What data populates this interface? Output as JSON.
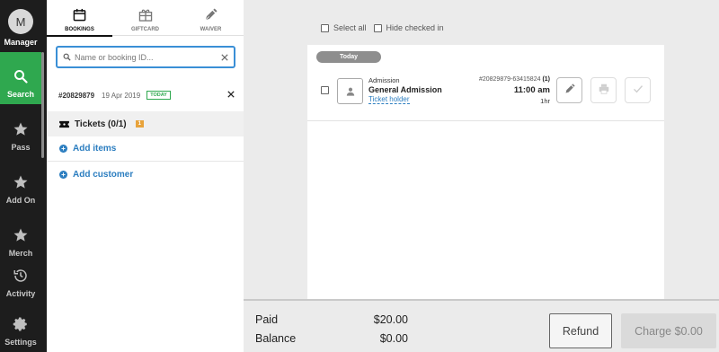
{
  "nav": {
    "manager": {
      "initial": "M",
      "label": "Manager"
    },
    "items": [
      {
        "label": "Search",
        "icon": "search-icon",
        "active": true
      },
      {
        "label": "Pass",
        "icon": "star-icon"
      },
      {
        "label": "Add On",
        "icon": "star-icon"
      },
      {
        "label": "Merch",
        "icon": "star-icon"
      },
      {
        "label": "Activity",
        "icon": "history-icon"
      },
      {
        "label": "Settings",
        "icon": "gear-icon"
      }
    ]
  },
  "tabs": [
    {
      "label": "BOOKINGS",
      "icon": "calendar-icon",
      "active": true
    },
    {
      "label": "GIFTCARD",
      "icon": "gift-icon"
    },
    {
      "label": "WAIVER",
      "icon": "pen-icon"
    }
  ],
  "search": {
    "placeholder": "Name or booking ID...",
    "value": ""
  },
  "booking": {
    "number": "#20829879",
    "date": "19 Apr 2019",
    "badge": "TODAY"
  },
  "tickets": {
    "label": "Tickets (0/1)",
    "count": "1"
  },
  "actions": {
    "add_items": "Add items",
    "add_customer": "Add customer"
  },
  "filters": {
    "select_all": "Select all",
    "hide_checked_in": "Hide checked in"
  },
  "day_label": "Today",
  "ticket": {
    "type": "Admission",
    "name": "General Admission",
    "holder": "Ticket holder",
    "ref": "#20829879-63415824",
    "qty": "(1)",
    "time": "11:00 am",
    "duration": "1hr"
  },
  "totals": {
    "paid_label": "Paid",
    "paid_value": "$20.00",
    "balance_label": "Balance",
    "balance_value": "$0.00"
  },
  "buttons": {
    "refund": "Refund",
    "charge": "Charge $0.00"
  },
  "colors": {
    "accent_green": "#2fa84f",
    "link_blue": "#2c7ec0",
    "badge_orange": "#e8a33b"
  }
}
